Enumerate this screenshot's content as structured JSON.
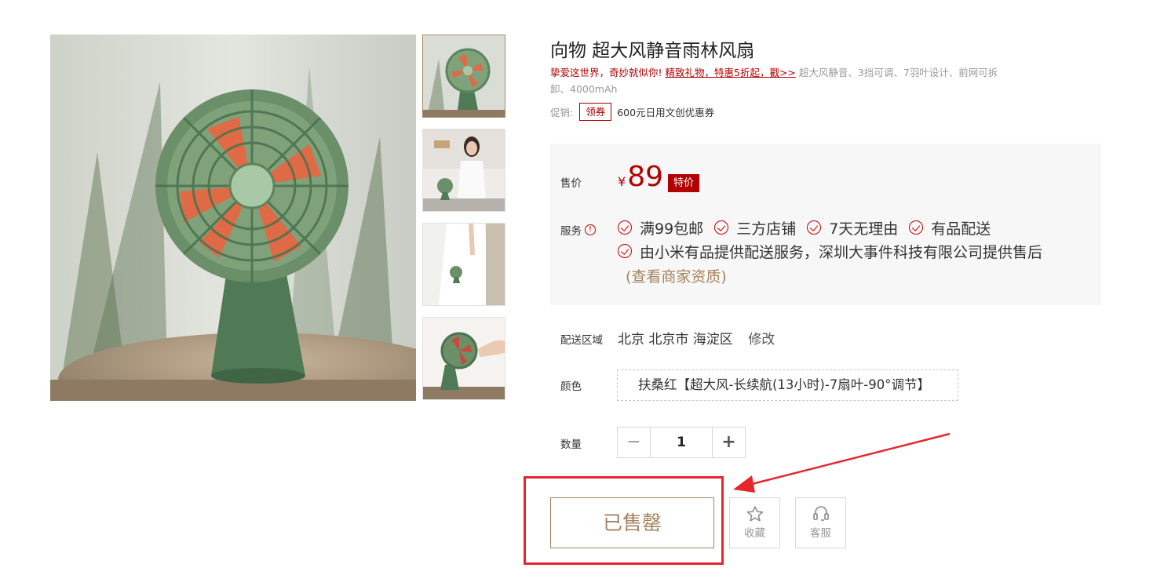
{
  "product": {
    "title": "向物 超大风静音雨林风扇",
    "subtitle_red": "挚爱这世界，奇妙就似你!",
    "subtitle_link": "精致礼物，特惠5折起，戳>>",
    "subtitle_desc": "超大风静音、3挡可调、7羽叶设计、前网可拆卸、4000mAh"
  },
  "promo": {
    "label": "促销:",
    "coupon_tag": "领券",
    "text": "600元日用文创优惠券"
  },
  "price": {
    "label": "售价",
    "currency": "¥",
    "value": "89",
    "tag": "特价"
  },
  "service": {
    "label": "服务",
    "info_icon_text": "!",
    "items": [
      "满99包邮",
      "三方店铺",
      "7天无理由",
      "有品配送"
    ],
    "note": "由小米有品提供配送服务，深圳大事件科技有限公司提供售后",
    "qualification_link": "(查看商家资质)"
  },
  "delivery": {
    "label": "配送区域",
    "address": "北京 北京市 海淀区",
    "edit_label": "修改"
  },
  "color": {
    "label": "颜色",
    "selected": "扶桑红【超大风-长续航(13小时)-7扇叶-90°调节】"
  },
  "quantity": {
    "label": "数量",
    "minus": "−",
    "value": "1",
    "plus": "+"
  },
  "actions": {
    "soldout_label": "已售罄",
    "favorite_label": "收藏",
    "service_label": "客服"
  },
  "colors": {
    "accent_red": "#b30000",
    "gold": "#a4845e",
    "annotation_red": "#e5262b"
  }
}
